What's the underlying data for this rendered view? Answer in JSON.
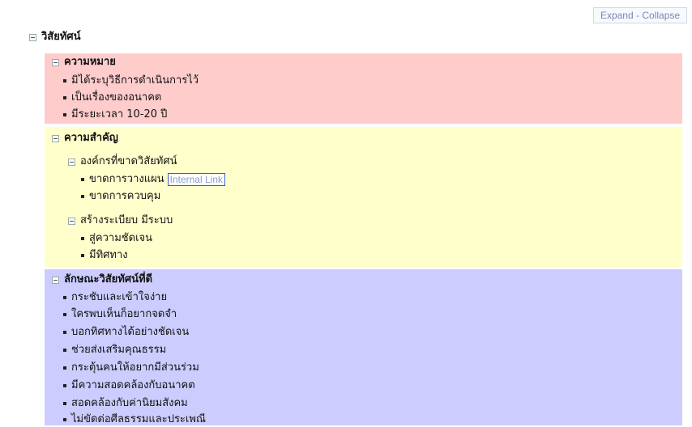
{
  "toolbar": {
    "expand": "Expand",
    "separator": "-",
    "collapse": "Collapse"
  },
  "root": "วิสัยทัศน์",
  "meaning": {
    "title": "ความหมาย",
    "items": [
      "มิได้ระบุวิธีการดำเนินการไว้",
      "เป็นเรื่องของอนาคต",
      "มีระยะเวลา 10-20 ปี"
    ],
    "color": "#ffcccc"
  },
  "importance": {
    "title": "ความสำคัญ",
    "color": "#ffffcc",
    "org": {
      "title": "องค์กรที่ขาดวิสัยทัศน์",
      "items": [
        "ขาดการวางแผน",
        "ขาดการควบคุม"
      ],
      "link_text": "Internal Link"
    },
    "system": {
      "title": "สร้างระเบียบ มีระบบ",
      "items": [
        "สู่ความชัดเจน",
        "มีทิศทาง"
      ]
    }
  },
  "good": {
    "title": "ลักษณะวิสัยทัศน์ที่ดี",
    "color": "#ccccff",
    "items": [
      "กระชับและเข้าใจง่าย",
      "ใครพบเห็นก็อยากจดจำ",
      "บอกทิศทางได้อย่างชัดเจน",
      "ช่วยส่งเสริมคุณธรรม",
      "กระตุ้นคนให้อยากมีส่วนร่วม",
      "มีความสอดคล้องกับอนาคต",
      "สอดคล้องกับค่านิยมสังคม",
      "ไม่ขัดต่อศีลธรรมและประเพณี"
    ]
  }
}
